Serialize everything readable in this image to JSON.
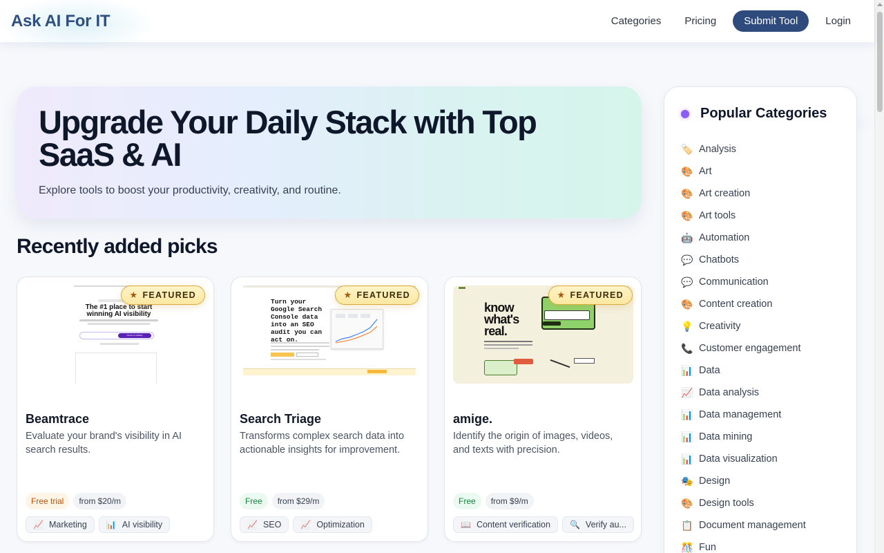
{
  "header": {
    "brand": "Ask AI For IT",
    "nav": {
      "categories": "Categories",
      "pricing": "Pricing",
      "submit": "Submit Tool",
      "login": "Login"
    }
  },
  "hero": {
    "title": "Upgrade Your Daily Stack with Top SaaS & AI",
    "subtitle": "Explore tools to boost your productivity, creativity, and routine."
  },
  "section_title": "Recently added picks",
  "featured_label": "FEATURED",
  "cards": [
    {
      "name": "Beamtrace",
      "description": "Evaluate your brand's visibility in AI search results.",
      "price_type": "Free trial",
      "price_from": "from $20/m",
      "tags": [
        {
          "icon": "📈",
          "label": "Marketing"
        },
        {
          "icon": "📊",
          "label": "AI visibility"
        }
      ],
      "thumb": {
        "headline": "The #1 place to start winning AI visibility",
        "button": "Check AI visibility"
      }
    },
    {
      "name": "Search Triage",
      "description": "Transforms complex search data into actionable insights for improvement.",
      "price_type": "Free",
      "price_from": "from $29/m",
      "tags": [
        {
          "icon": "📈",
          "label": "SEO"
        },
        {
          "icon": "📈",
          "label": "Optimization"
        }
      ],
      "thumb": {
        "headline": "Turn your Google Search Console data into an SEO audit you can act on."
      }
    },
    {
      "name": "amige.",
      "description": "Identify the origin of images, videos, and texts with precision.",
      "price_type": "Free",
      "price_from": "from $9/m",
      "tags": [
        {
          "icon": "📖",
          "label": "Content verification"
        },
        {
          "icon": "🔍",
          "label": "Verify au..."
        }
      ],
      "thumb": {
        "headline": "know what's real."
      }
    }
  ],
  "sidebar": {
    "title": "Popular Categories",
    "accent": "#8b5cf6",
    "items": [
      {
        "icon": "🏷️",
        "label": "Analysis"
      },
      {
        "icon": "🎨",
        "label": "Art"
      },
      {
        "icon": "🎨",
        "label": "Art creation"
      },
      {
        "icon": "🎨",
        "label": "Art tools"
      },
      {
        "icon": "🤖",
        "label": "Automation"
      },
      {
        "icon": "💬",
        "label": "Chatbots"
      },
      {
        "icon": "💬",
        "label": "Communication"
      },
      {
        "icon": "🎨",
        "label": "Content creation"
      },
      {
        "icon": "💡",
        "label": "Creativity"
      },
      {
        "icon": "📞",
        "label": "Customer engagement"
      },
      {
        "icon": "📊",
        "label": "Data"
      },
      {
        "icon": "📈",
        "label": "Data analysis"
      },
      {
        "icon": "📊",
        "label": "Data management"
      },
      {
        "icon": "📊",
        "label": "Data mining"
      },
      {
        "icon": "📊",
        "label": "Data visualization"
      },
      {
        "icon": "🎭",
        "label": "Design"
      },
      {
        "icon": "🎨",
        "label": "Design tools"
      },
      {
        "icon": "📋",
        "label": "Document management"
      },
      {
        "icon": "🎊",
        "label": "Fun"
      }
    ]
  }
}
